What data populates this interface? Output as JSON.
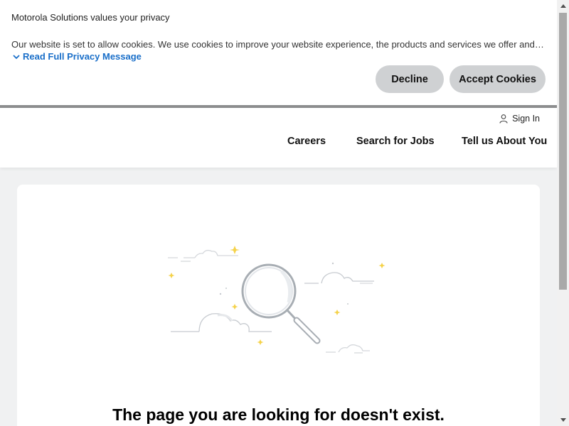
{
  "cookie_banner": {
    "title": "Motorola Solutions values your privacy",
    "text": "Our website is set to allow cookies. We use cookies to improve your website experience, the products and services we offer and to make your experience more relevant.",
    "read_more": "Read Full Privacy Message",
    "decline": "Decline",
    "accept": "Accept Cookies"
  },
  "header": {
    "sign_in": "Sign In",
    "nav": [
      "Careers",
      "Search for Jobs",
      "Tell us About You"
    ]
  },
  "main": {
    "headline": "The page you are looking for doesn't exist."
  },
  "colors": {
    "link": "#1a6fc9",
    "button_bg": "#cfd1d3",
    "page_bg": "#f0f1f2",
    "sparkle": "#f5d24a"
  },
  "icons": [
    "chevron-down-icon",
    "user-icon",
    "magnifier-illustration"
  ]
}
